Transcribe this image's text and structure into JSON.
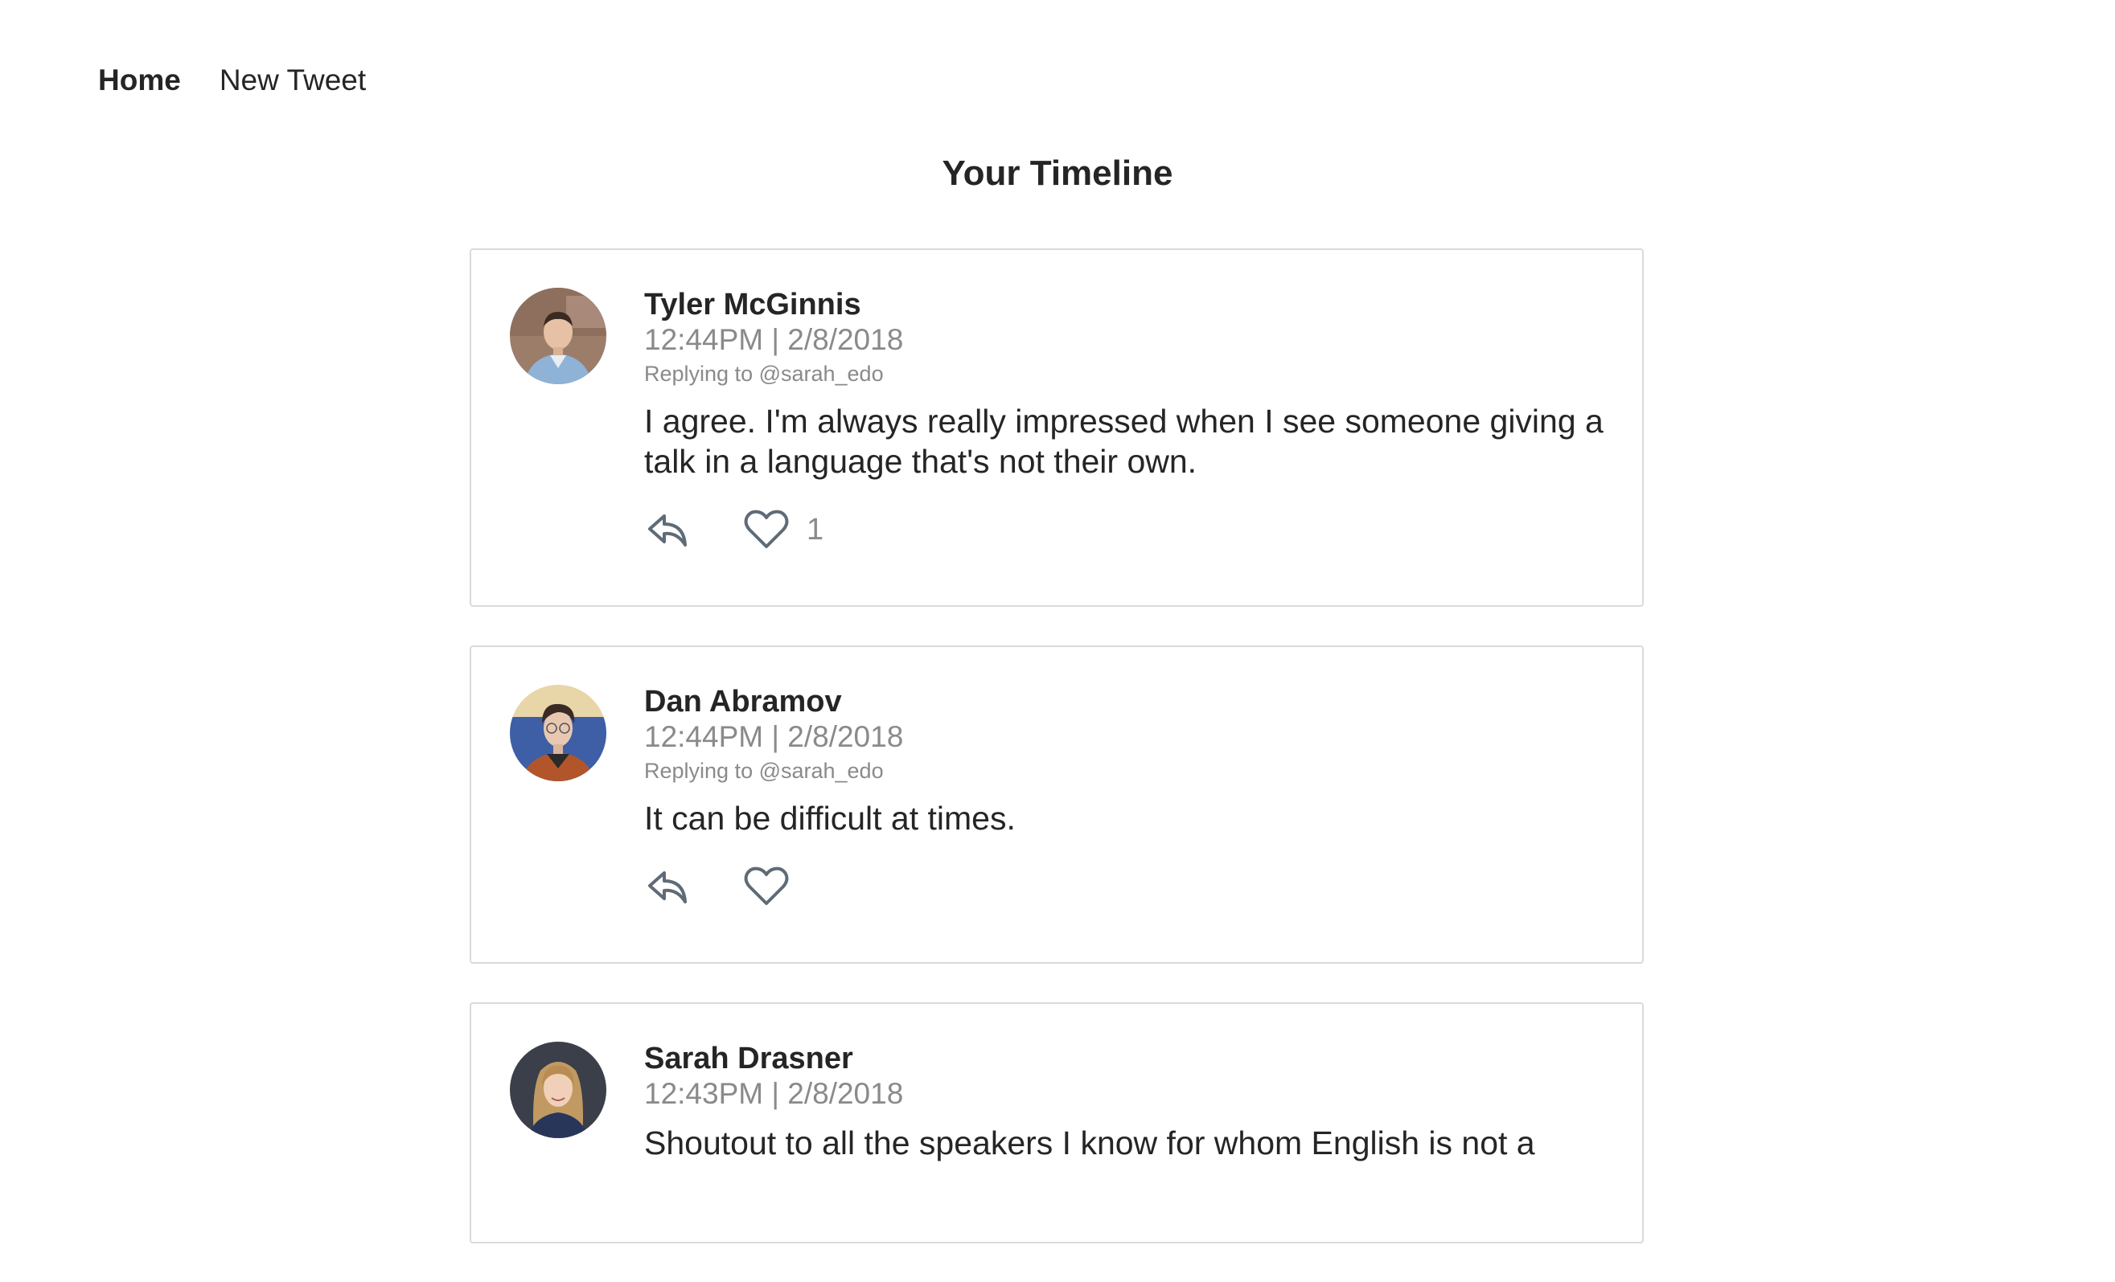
{
  "nav": {
    "items": [
      {
        "label": "Home",
        "active": true
      },
      {
        "label": "New Tweet",
        "active": false
      }
    ]
  },
  "page": {
    "title": "Your Timeline"
  },
  "colors": {
    "text": "#252525",
    "muted": "#8a8a8a",
    "border": "#dadada",
    "icon": "#5f6b76"
  },
  "icons": {
    "reply": "reply-arrow-icon",
    "like": "heart-outline-icon"
  },
  "tweets": [
    {
      "author": "Tyler McGinnis",
      "timestamp": "12:44PM | 2/8/2018",
      "replying_to": "Replying to @sarah_edo",
      "text": "I agree. I'm always really impressed when I see someone giving a talk in a language that's not their own.",
      "likes": "1"
    },
    {
      "author": "Dan Abramov",
      "timestamp": "12:44PM | 2/8/2018",
      "replying_to": "Replying to @sarah_edo",
      "text": "It can be difficult at times.",
      "likes": ""
    },
    {
      "author": "Sarah Drasner",
      "timestamp": "12:43PM | 2/8/2018",
      "replying_to": "",
      "text": "Shoutout to all the speakers I know for whom English is not a",
      "likes": ""
    }
  ]
}
